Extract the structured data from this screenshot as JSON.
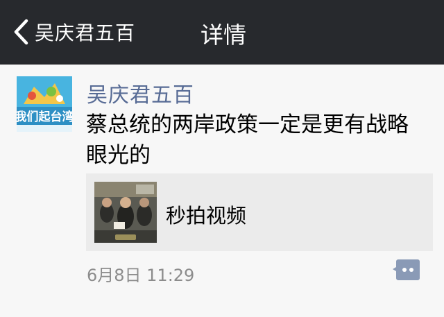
{
  "nav": {
    "back_label": "吴庆君五百",
    "title": "详情"
  },
  "post": {
    "author": "吴庆君五百",
    "text": "蔡总统的两岸政策一定是更有战略眼光的",
    "link_card": {
      "title": "秒拍视频",
      "thumbnail": "video-thumbnail-crowd"
    },
    "timestamp": "6月8日 11:29",
    "avatar_text": "我们起台湾"
  },
  "colors": {
    "navbar_bg": "#27292d",
    "author_link": "#576b95",
    "comment_icon": "#8a9ab6",
    "background": "#f7f7f7"
  },
  "icons": {
    "back": "chevron-left-icon",
    "comment": "comment-bubble-icon"
  }
}
